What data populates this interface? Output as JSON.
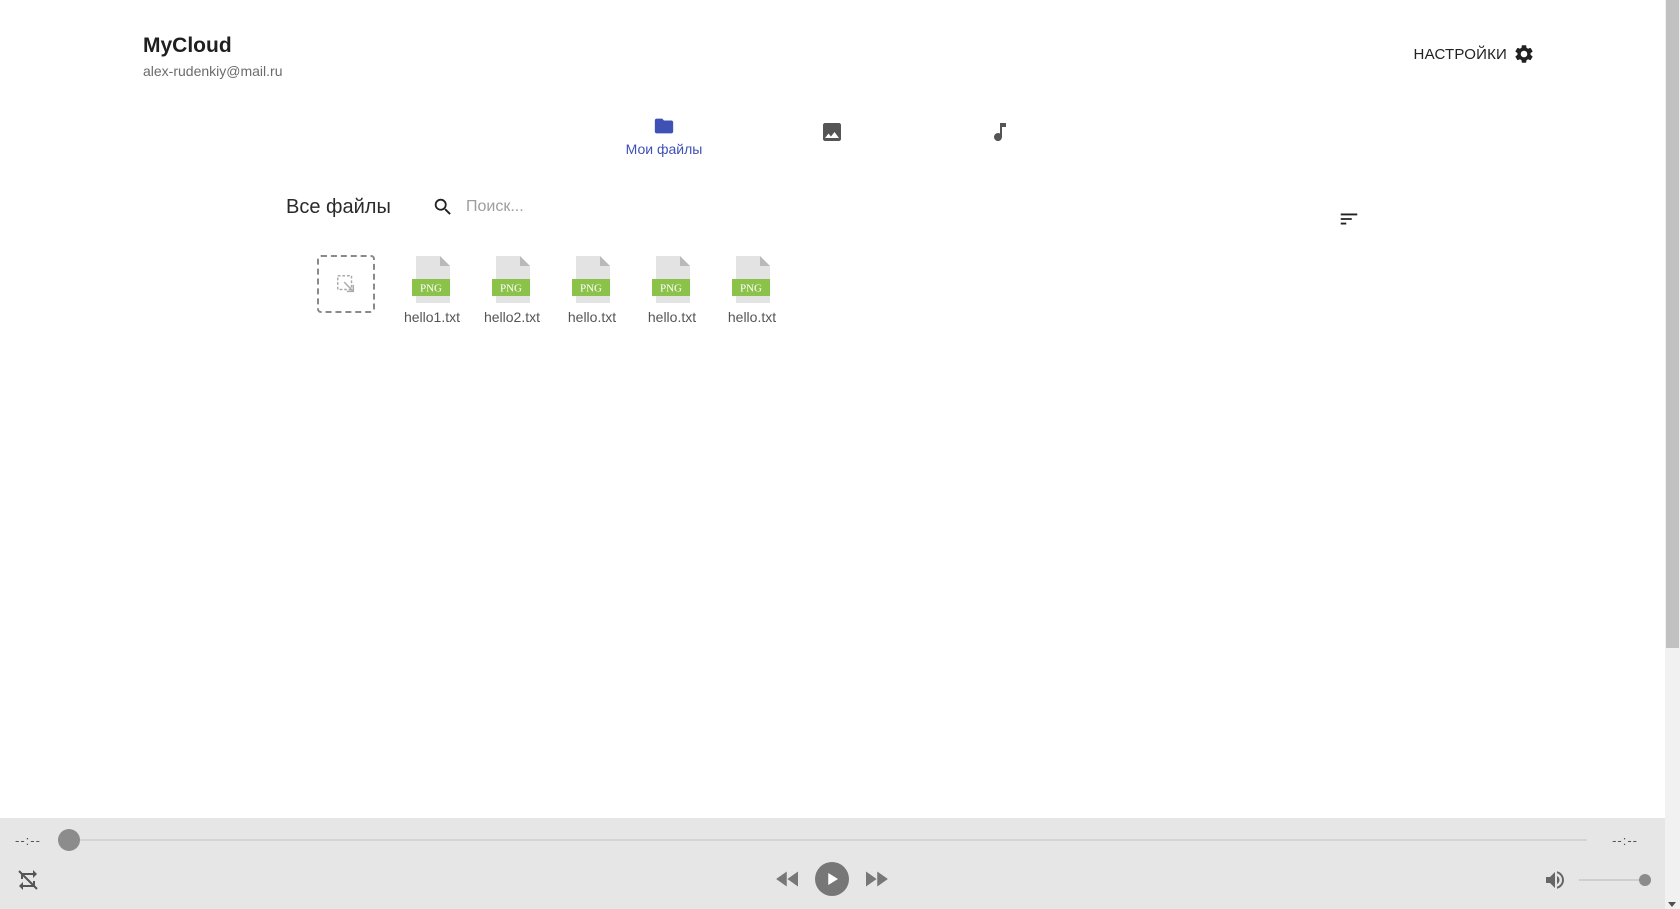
{
  "header": {
    "app_title": "MyCloud",
    "user_email": "alex-rudenkiy@mail.ru",
    "settings_label": "НАСТРОЙКИ"
  },
  "tabs": [
    {
      "label": "Мои файлы",
      "icon": "folder-icon",
      "active": true
    },
    {
      "label": "",
      "icon": "image-icon",
      "active": false
    },
    {
      "label": "",
      "icon": "music-note-icon",
      "active": false
    }
  ],
  "toolbar": {
    "section_title": "Все файлы",
    "search_placeholder": "Поиск...",
    "search_value": ""
  },
  "files": [
    {
      "name": "hello1.txt",
      "badge": "PNG"
    },
    {
      "name": "hello2.txt",
      "badge": "PNG"
    },
    {
      "name": "hello.txt",
      "badge": "PNG"
    },
    {
      "name": "hello.txt",
      "badge": "PNG"
    },
    {
      "name": "hello.txt",
      "badge": "PNG"
    }
  ],
  "player": {
    "current_time": "--:--",
    "total_time": "--:--",
    "progress": 0,
    "volume": 1.0
  },
  "colors": {
    "accent": "#3f51b5",
    "icon_dark": "#555555",
    "png_badge": "#8bc34a",
    "player_bg": "#e6e6e6"
  }
}
